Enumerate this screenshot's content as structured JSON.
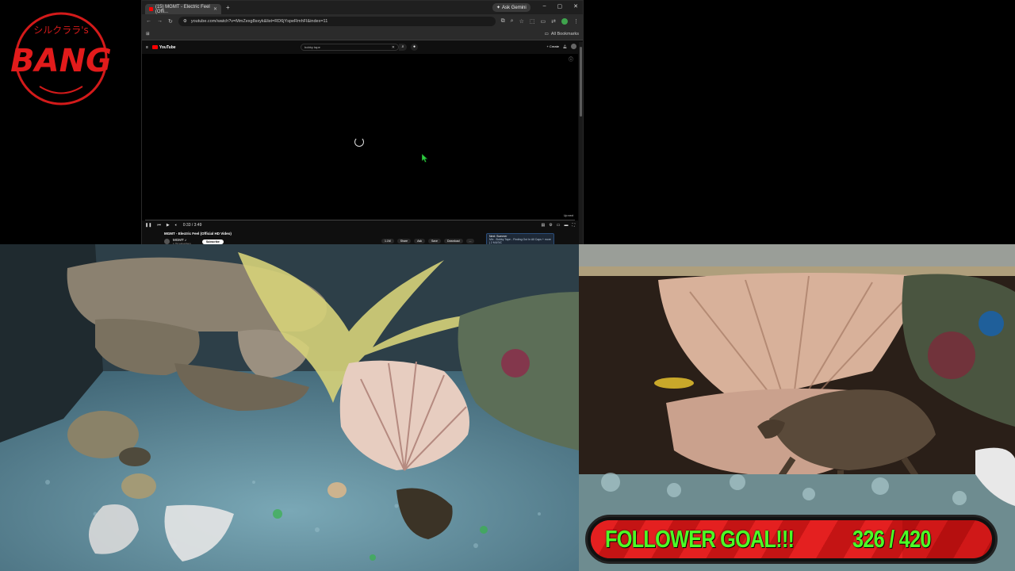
{
  "overlay": {
    "logo_text": "BANG",
    "logo_arc_text": "シルクララ's",
    "goal_label": "FOLLOWER GOAL!!!",
    "goal_count": "326 / 420",
    "goal_current": 326,
    "goal_target": 420,
    "goal_text_color": "#4cff26",
    "goal_bar_color": "#d01818"
  },
  "browser": {
    "tab_title": "(15) MGMT - Electric Feel (Offi...",
    "new_tab": "+",
    "gemini_label": "Ask Gemini",
    "url": "youtube.com/watch?v=MmZexg8sxyk&list=RD6jYspeRmhFI&index=11",
    "bookmarks_label": "All Bookmarks",
    "window_controls": [
      "–",
      "▢",
      "✕"
    ]
  },
  "youtube": {
    "logo": "YouTube",
    "search_value": "bobby tape",
    "create_label": "+ Create",
    "notif_count": "9+",
    "time": "0:33 / 3:49",
    "upnext_small": "Up next",
    "video_title": "MGMT - Electric Feel (Official HD Video)",
    "channel_name": "MGMT ♪",
    "subscribers": "1.7M subscribers",
    "subscribe_label": "Subscribe",
    "actions": [
      "1.1M",
      "Share",
      "Ask",
      "Save",
      "Download",
      "..."
    ],
    "next_title": "Next: Summer",
    "next_subtitle": "Mix - Bobby Tape - Finding Out In All Caps + more | 2 MUSIC"
  }
}
